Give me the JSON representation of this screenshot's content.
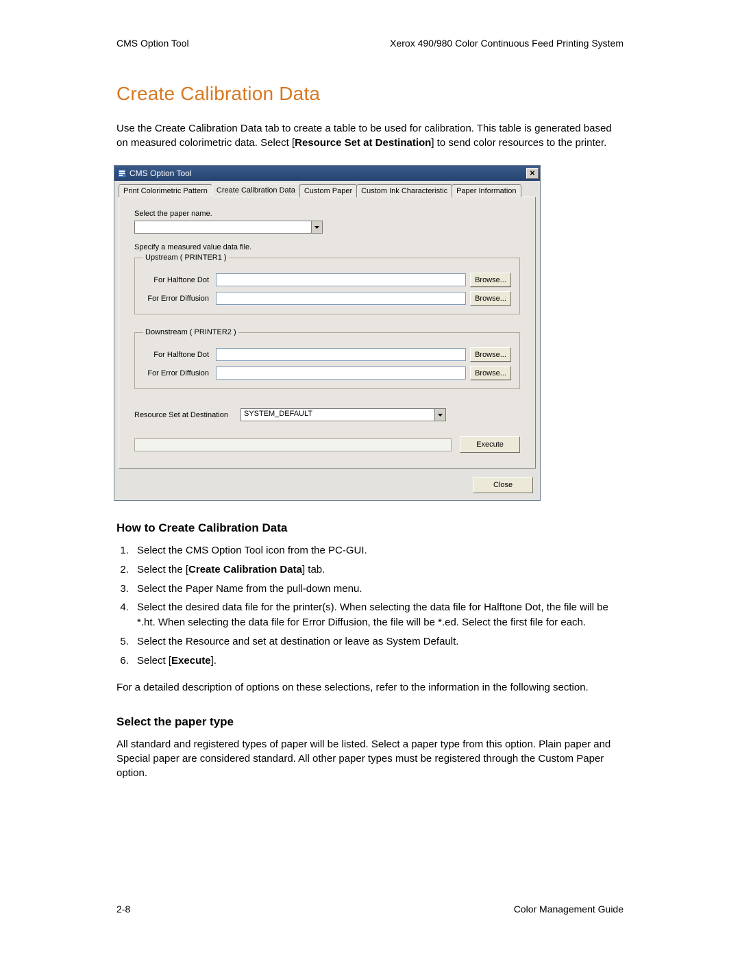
{
  "header": {
    "left": "CMS Option Tool",
    "right": "Xerox 490/980 Color Continuous Feed Printing System"
  },
  "title": "Create Calibration Data",
  "intro": {
    "pre": "Use the Create Calibration Data tab to create a table to be used for calibration. This table is generated based on measured colorimetric data. Select [",
    "bold": "Resource Set at Destination",
    "post": "] to send color resources to the printer."
  },
  "dialog": {
    "title": "CMS Option Tool",
    "tabs": [
      "Print Colorimetric Pattern",
      "Create Calibration Data",
      "Custom Paper",
      "Custom Ink Characteristic",
      "Paper Information"
    ],
    "selectPaperLabel": "Select the paper name.",
    "paperSelected": "",
    "specifyLabel": "Specify a measured value data file.",
    "upstreamLegend": "Upstream ( PRINTER1 )",
    "downstreamLegend": "Downstream ( PRINTER2 )",
    "halftoneLabel": "For Halftone Dot",
    "errorDiffLabel": "For Error Diffusion",
    "browse": "Browse...",
    "resourceLabel": "Resource Set at Destination",
    "resourceValue": "SYSTEM_DEFAULT",
    "execute": "Execute",
    "close": "Close"
  },
  "howto": {
    "heading": "How to Create Calibration Data",
    "steps": [
      {
        "text": "Select the CMS Option Tool icon from the PC-GUI."
      },
      {
        "pre": "Select the [",
        "bold": "Create Calibration Data",
        "post": "] tab."
      },
      {
        "text": "Select the Paper Name from the pull-down menu."
      },
      {
        "text": "Select the desired data file for the printer(s). When selecting the data file for Halftone Dot, the file will be *.ht. When selecting the data file for Error Diffusion, the file will be *.ed. Select the first file for each."
      },
      {
        "text": "Select the Resource and set at destination or leave as System Default."
      },
      {
        "pre": "Select [",
        "bold": "Execute",
        "post": "]."
      }
    ],
    "after": "For a detailed description of options on these selections, refer to the information in the following section."
  },
  "select_paper": {
    "heading": "Select the paper type",
    "body": "All standard and registered types of paper will be listed. Select a paper type from this option. Plain paper and Special paper are considered standard. All other paper types must be registered through the Custom Paper option."
  },
  "footer": {
    "left": "2-8",
    "right": "Color Management Guide"
  }
}
